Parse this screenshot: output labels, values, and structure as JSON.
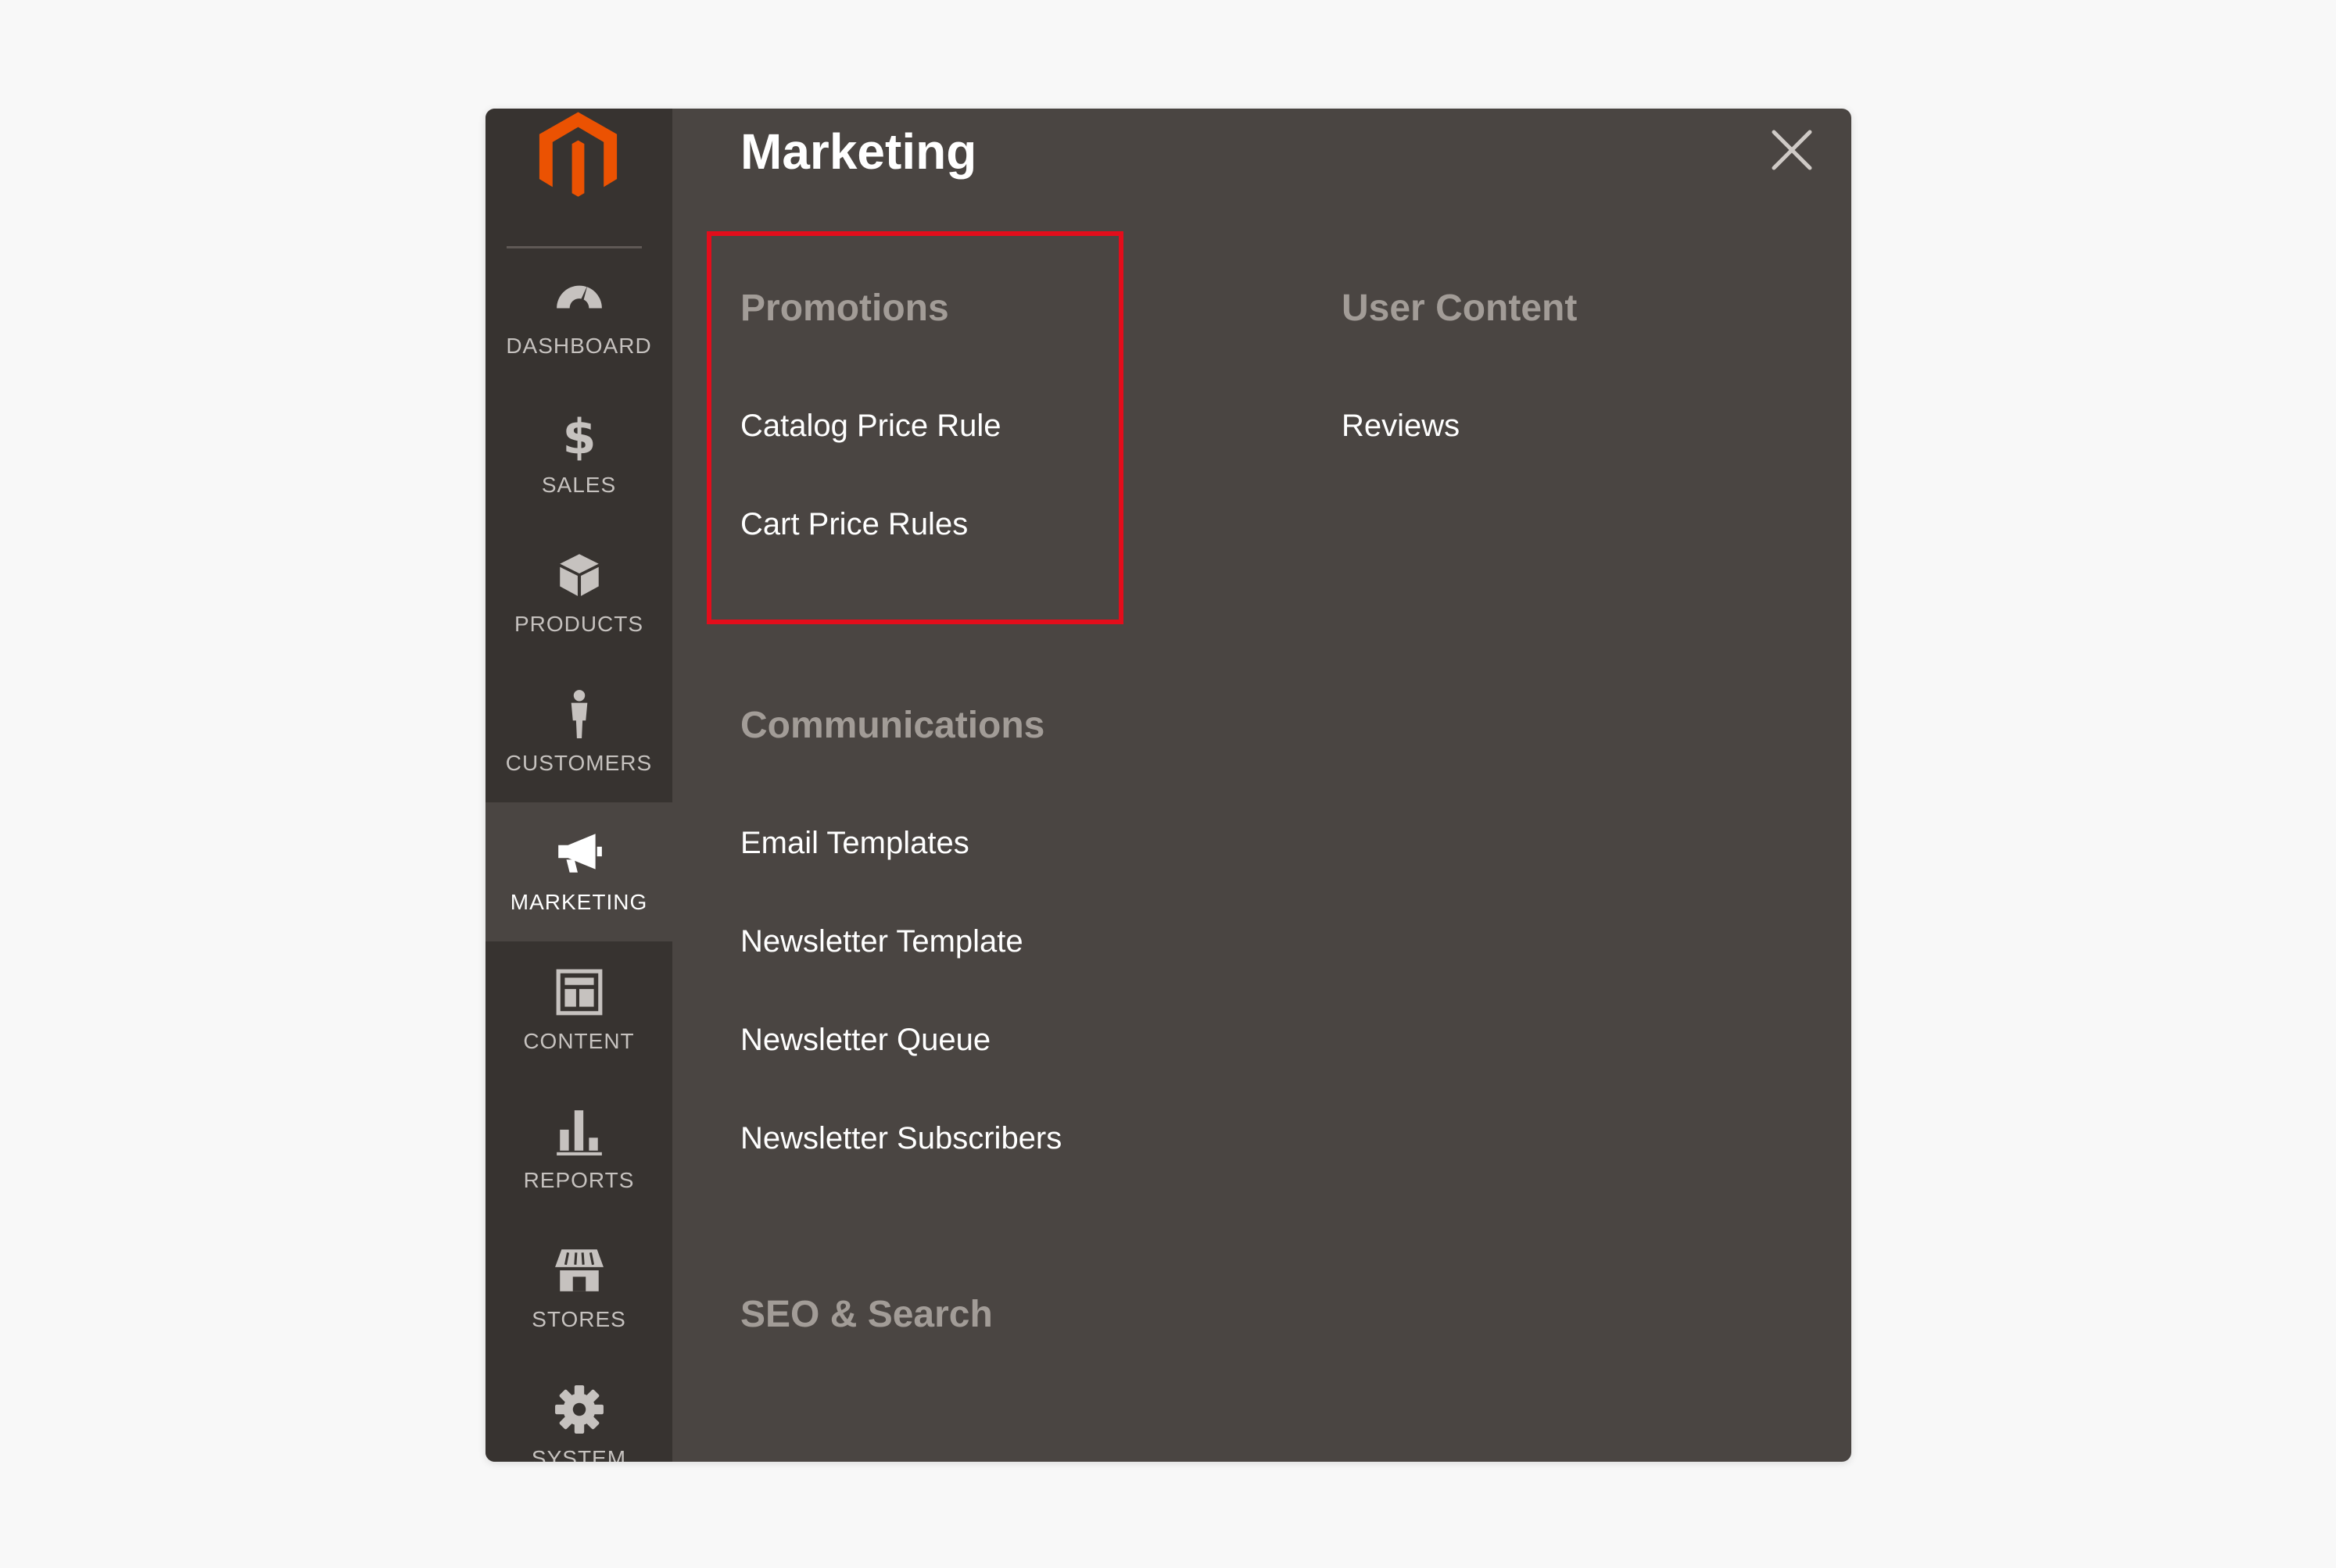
{
  "colors": {
    "page_background": "#f8f8f8",
    "panel_background": "#4a4542",
    "sidebar_background": "#373330",
    "brand_orange": "#eb5202",
    "group_title": "#a29c97",
    "link_text": "#ffffff",
    "highlight_border": "#e30d1b"
  },
  "sidebar": {
    "logo_icon": "magento-logo-icon",
    "items": [
      {
        "label": "DASHBOARD",
        "icon": "dashboard-gauge-icon",
        "active": false
      },
      {
        "label": "SALES",
        "icon": "dollar-icon",
        "active": false
      },
      {
        "label": "PRODUCTS",
        "icon": "box-icon",
        "active": false
      },
      {
        "label": "CUSTOMERS",
        "icon": "person-icon",
        "active": false
      },
      {
        "label": "MARKETING",
        "icon": "megaphone-icon",
        "active": true
      },
      {
        "label": "CONTENT",
        "icon": "layout-icon",
        "active": false
      },
      {
        "label": "REPORTS",
        "icon": "bar-chart-icon",
        "active": false
      },
      {
        "label": "STORES",
        "icon": "storefront-icon",
        "active": false
      },
      {
        "label": "SYSTEM",
        "icon": "gear-icon",
        "active": false
      }
    ]
  },
  "panel": {
    "title": "Marketing",
    "close_icon": "close-icon",
    "groups": {
      "promotions": {
        "title": "Promotions",
        "links": [
          "Catalog Price Rule",
          "Cart Price Rules"
        ],
        "highlighted": true
      },
      "user_content": {
        "title": "User Content",
        "links": [
          "Reviews"
        ]
      },
      "communications": {
        "title": "Communications",
        "links": [
          "Email Templates",
          "Newsletter Template",
          "Newsletter Queue",
          "Newsletter Subscribers"
        ]
      },
      "seo_search": {
        "title": "SEO & Search",
        "links": []
      }
    }
  }
}
